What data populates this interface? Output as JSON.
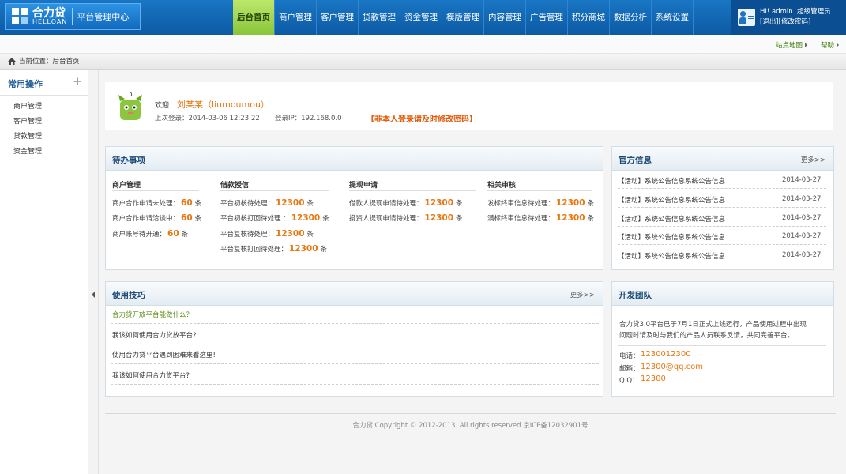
{
  "brand": {
    "name": "合力贷",
    "sub": "HELLOAN",
    "system": "平台管理中心"
  },
  "nav": [
    {
      "label": "后台首页",
      "active": true
    },
    {
      "label": "商户管理"
    },
    {
      "label": "客户管理"
    },
    {
      "label": "贷款管理"
    },
    {
      "label": "资金管理"
    },
    {
      "label": "模版管理"
    },
    {
      "label": "内容管理"
    },
    {
      "label": "广告管理"
    },
    {
      "label": "积分商城"
    },
    {
      "label": "数据分析"
    },
    {
      "label": "系统设置"
    }
  ],
  "user": {
    "greeting": "HI! admin",
    "role": "超级管理员",
    "logout": "[退出]",
    "change_pw": "[修改密码]"
  },
  "subbar": {
    "sitemap": "站点地图",
    "help": "帮助"
  },
  "breadcrumb": {
    "text": "当前位置：后台首页"
  },
  "sidebar": {
    "title": "常用操作",
    "plus": "+",
    "items": [
      "商户管理",
      "客户管理",
      "贷款管理",
      "资金管理"
    ]
  },
  "welcome": {
    "hello": "欢迎",
    "name": "刘某某（liumoumou）",
    "last_login": "上次登录：2014-03-06  12:23:22",
    "ip": "登录IP：192.168.0.0",
    "warning": "【非本人登录请及时修改密码】"
  },
  "todo": {
    "title": "待办事项",
    "columns": [
      {
        "header": "商户管理",
        "rows": [
          {
            "label": "商户合作申请未处理：",
            "value": "60",
            "unit": "条"
          },
          {
            "label": "商户合作申请洽谈中：",
            "value": "60",
            "unit": "条"
          },
          {
            "label": "商户账号待开通：",
            "value": "60",
            "unit": "条"
          }
        ]
      },
      {
        "header": "借款授信",
        "rows": [
          {
            "label": "平台初核待处理：",
            "value": "12300",
            "unit": "条"
          },
          {
            "label": "平台初核打回待处理 ：",
            "value": "12300",
            "unit": "条"
          },
          {
            "label": "平台复核待处理：",
            "value": "12300",
            "unit": "条"
          },
          {
            "label": "平台复核打回待处理：",
            "value": "12300",
            "unit": "条"
          }
        ]
      },
      {
        "header": "提现申请",
        "rows": [
          {
            "label": "借款人提现申请待处理：",
            "value": "12300",
            "unit": "条"
          },
          {
            "label": "投资人提现申请待处理：",
            "value": "12300",
            "unit": "条"
          }
        ]
      },
      {
        "header": "相关审核",
        "rows": [
          {
            "label": "发标终审信息待处理：",
            "value": "12300",
            "unit": "条"
          },
          {
            "label": "满标终审信息待处理：",
            "value": "12300",
            "unit": "条"
          }
        ]
      }
    ]
  },
  "official": {
    "title": "官方信息",
    "more": "更多>>",
    "items": [
      {
        "text": "【活动】系统公告信息系统公告信息",
        "date": "2014-03-27"
      },
      {
        "text": "【活动】系统公告信息系统公告信息",
        "date": "2014-03-27"
      },
      {
        "text": "【活动】系统公告信息系统公告信息",
        "date": "2014-03-27"
      },
      {
        "text": "【活动】系统公告信息系统公告信息",
        "date": "2014-03-27"
      },
      {
        "text": "【活动】系统公告信息系统公告信息",
        "date": "2014-03-27"
      }
    ]
  },
  "tips": {
    "title": "使用技巧",
    "more": "更多>>",
    "items": [
      "合力贷开放平台能做什么？",
      "我该如何使用合力贷放平台?",
      "使用合力贷平台遇到困难来看这里!",
      "我该如何使用合力贷平台?"
    ]
  },
  "team": {
    "title": "开发团队",
    "desc_line1": "合力贷3.0平台已于7月1日正式上线运行，产品使用过程中出现",
    "desc_line2": "问题时请及时与我们的产品人员联系反馈，共同完善平台。",
    "contacts": [
      {
        "label": "电话：",
        "value": "1230012300"
      },
      {
        "label": "邮箱：",
        "value": "12300@qq.com"
      },
      {
        "label": "Q  Q：",
        "value": "12300"
      }
    ]
  },
  "footer": {
    "text": "合力贷  Copyright © 2012-2013. All  rights  reserved    京ICP备12032901号"
  },
  "colors": {
    "accent": "#e9760e",
    "nav": "#1976c4",
    "active_nav": "#a3d756"
  }
}
